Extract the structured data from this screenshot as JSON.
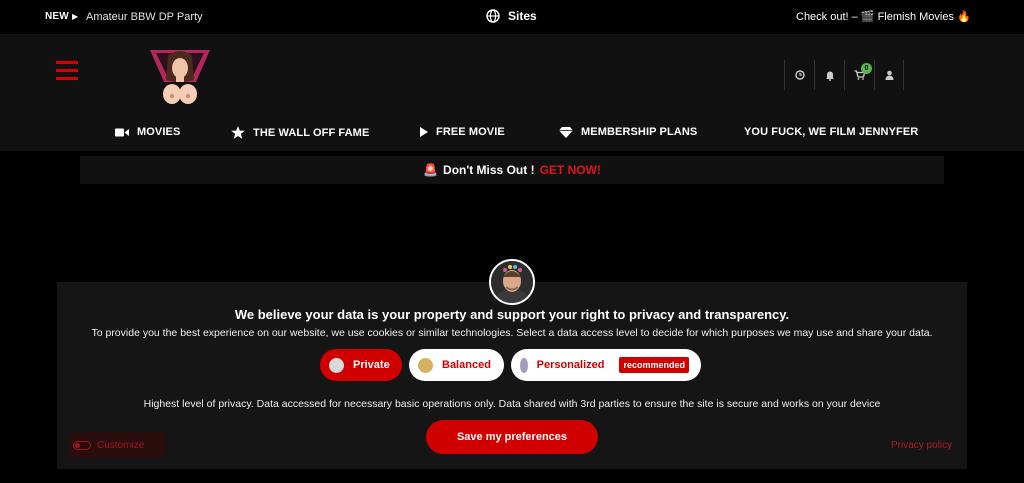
{
  "topbar": {
    "new_label": "NEW",
    "promo_text": "Amateur BBW DP Party",
    "sites_label": "Sites",
    "checkout_text": "Check out! – 🎬 Flemish Movies 🔥"
  },
  "header": {
    "cart_count": "0",
    "nav": [
      {
        "label": "MOVIES",
        "icon": "video-icon"
      },
      {
        "label": "THE WALL OFF FAME",
        "icon": "star-icon"
      },
      {
        "label": "FREE MOVIE",
        "icon": "play-icon"
      },
      {
        "label": "MEMBERSHIP PLANS",
        "icon": "diamond-icon"
      },
      {
        "label": "YOU FUCK, WE FILM JENNYFER",
        "icon": ""
      }
    ]
  },
  "alert": {
    "siren": "🚨",
    "text": "Don't Miss Out !",
    "cta": "GET NOW!"
  },
  "consent": {
    "title": "We believe your data is your property and support your right to privacy and transparency.",
    "description": "To provide you the best experience on our website, we use cookies or similar technologies. Select a data access level to decide for which purposes we may use and share your data.",
    "levels": [
      {
        "label": "Private"
      },
      {
        "label": "Balanced"
      },
      {
        "label": "Personalized",
        "badge": "recommended"
      }
    ],
    "note": "Highest level of privacy. Data accessed for necessary basic operations only. Data shared with 3rd parties to ensure the site is secure and works on your device",
    "save_label": "Save my preferences",
    "customize_label": "Customize",
    "privacy_label": "Privacy policy"
  },
  "colors": {
    "accent": "#d00000",
    "badge_green": "#58b94c"
  }
}
